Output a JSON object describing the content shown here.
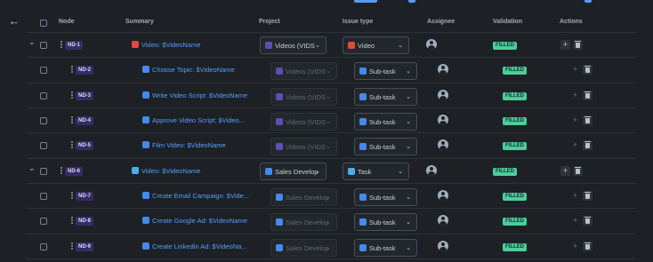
{
  "headers": {
    "node": "Node",
    "summary": "Summary",
    "project": "Project",
    "issue_type": "Issue type",
    "assignee": "Assignee",
    "validation": "Validation",
    "actions": "Actions"
  },
  "rows": [
    {
      "id": "ND-1",
      "summary": "Video: $VideoName",
      "project": "Videos (VIDS",
      "issue_type": "Video",
      "validation": "FILLED"
    },
    {
      "id": "ND-2",
      "summary": "Choose Topic: $VideoName",
      "project": "Videos (VIDS",
      "issue_type": "Sub-task",
      "validation": "FILLED"
    },
    {
      "id": "ND-3",
      "summary": "Write Video Script: $VideoName",
      "project": "Videos (VIDS",
      "issue_type": "Sub-task",
      "validation": "FILLED"
    },
    {
      "id": "ND-4",
      "summary": "Approve Video Script: $Video...",
      "project": "Videos (VIDS",
      "issue_type": "Sub-task",
      "validation": "FILLED"
    },
    {
      "id": "ND-5",
      "summary": "Film Video: $VideoName",
      "project": "Videos (VIDS",
      "issue_type": "Sub-task",
      "validation": "FILLED"
    },
    {
      "id": "ND-6",
      "summary": "Video: $VideoName",
      "project": "Sales Develop",
      "issue_type": "Task",
      "validation": "FILLED"
    },
    {
      "id": "ND-7",
      "summary": "Create Email Campaign: $Vide...",
      "project": "Sales Develop",
      "issue_type": "Sub-task",
      "validation": "FILLED"
    },
    {
      "id": "ND-8",
      "summary": "Create Google Ad: $VideoName",
      "project": "Sales Develop",
      "issue_type": "Sub-task",
      "validation": "FILLED"
    },
    {
      "id": "ND-9",
      "summary": "Create Linkedin Ad: $VideoNa...",
      "project": "Sales Develop",
      "issue_type": "Sub-task",
      "validation": "FILLED"
    }
  ],
  "icons": {
    "back": "arrow-left-icon",
    "add": "plus-icon",
    "delete": "trash-icon",
    "expand": "chevron-down-icon"
  },
  "colors": {
    "accent": "#579dff",
    "filled": "#4bce97",
    "story": "#e2483d",
    "subtask": "#4688ec",
    "task": "#4bade8"
  }
}
